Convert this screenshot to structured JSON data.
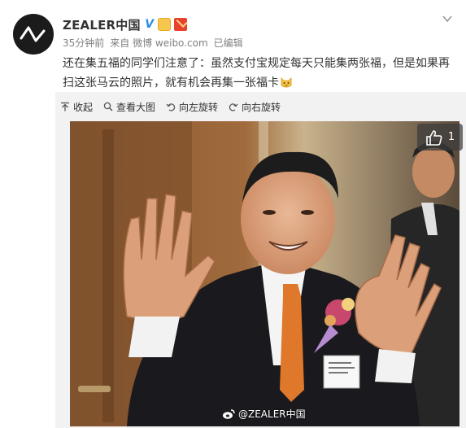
{
  "author": {
    "name": "ZEALER中国",
    "verified_mark": "V",
    "avatar_icon": "zealer-logo-icon"
  },
  "meta": {
    "time": "35分钟前",
    "source": "来自 微博 weibo.com",
    "edited": "已编辑"
  },
  "post": {
    "text": "还在集五福的同学们注意了：虽然支付宝规定每天只能集两张福，但是如果再扫这张马云的照片，就有机会再集一张福卡"
  },
  "toolbar": {
    "collapse": "收起",
    "view_large": "查看大图",
    "rotate_left": "向左旋转",
    "rotate_right": "向右旋转"
  },
  "photo": {
    "like_count": "1",
    "watermark": "@ZEALER中国"
  },
  "colors": {
    "link_blue": "#2a8de0",
    "meta_gray": "#808080",
    "panel_bg": "#f2f2f2"
  }
}
